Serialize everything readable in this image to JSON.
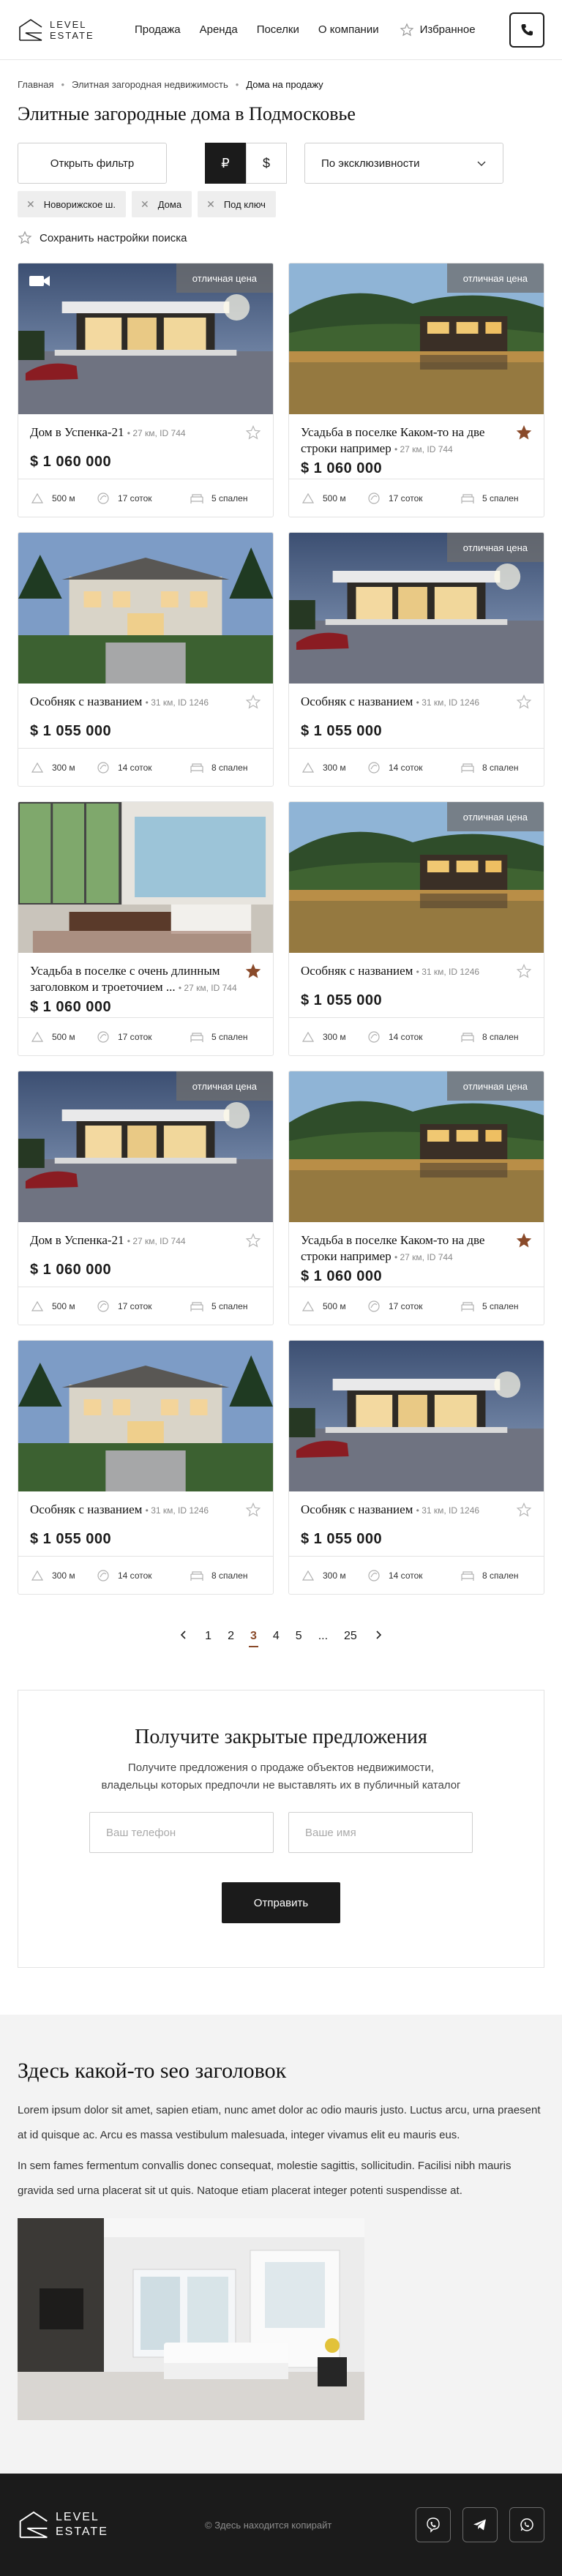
{
  "brand": {
    "line1": "LEVEL",
    "line2": "ESTATE"
  },
  "nav": [
    "Продажа",
    "Аренда",
    "Поселки",
    "О компании"
  ],
  "favorites_label": "Избранное",
  "breadcrumb": [
    "Главная",
    "Элитная загородная недвижимость",
    "Дома на продажу"
  ],
  "page_title": "Элитные загородные дома в Подмосковье",
  "controls": {
    "filter_label": "Открыть фильтр",
    "currency_rub": "₽",
    "currency_usd": "$",
    "sort_label": "По эксклюзивности"
  },
  "chips": [
    "Новорижское ш.",
    "Дома",
    "Под ключ"
  ],
  "save_search_label": "Сохранить настройки поиска",
  "accent_color": "#8a4a2a",
  "listings": [
    {
      "scene": "modern",
      "badge": "отличная цена",
      "video": true,
      "title": "Дом в Успенка-21",
      "meta": "• 27 км, ID 744",
      "fav": false,
      "price": "$ 1 060 000",
      "dist": "500 м",
      "area": "17 соток",
      "beds": "5 спален"
    },
    {
      "scene": "lake",
      "badge": "отличная цена",
      "video": false,
      "title": "Усадьба в поселке Каком-то на две строки например",
      "meta": "• 27 км, ID 744",
      "fav": true,
      "price": "$ 1 060 000",
      "dist": "500 м",
      "area": "17 соток",
      "beds": "5 спален"
    },
    {
      "scene": "mansion",
      "badge": "",
      "video": false,
      "title": "Особняк с названием",
      "meta": "• 31 км, ID 1246",
      "fav": false,
      "price": "$ 1 055 000",
      "dist": "300 м",
      "area": "14 соток",
      "beds": "8 спален"
    },
    {
      "scene": "modern",
      "badge": "отличная цена",
      "video": false,
      "title": "Особняк с названием",
      "meta": "• 31 км, ID 1246",
      "fav": false,
      "price": "$ 1 055 000",
      "dist": "300 м",
      "area": "14 соток",
      "beds": "8 спален"
    },
    {
      "scene": "interior",
      "badge": "",
      "video": false,
      "title": "Усадьба в поселке с очень длинным заголовком и троеточием ...",
      "meta": "• 27 км, ID 744",
      "fav": true,
      "price": "$ 1 060 000",
      "dist": "500 м",
      "area": "17 соток",
      "beds": "5 спален"
    },
    {
      "scene": "lake",
      "badge": "отличная цена",
      "video": false,
      "title": "Особняк с названием",
      "meta": "• 31 км, ID 1246",
      "fav": false,
      "price": "$ 1 055 000",
      "dist": "300 м",
      "area": "14 соток",
      "beds": "8 спален"
    },
    {
      "scene": "modern",
      "badge": "отличная цена",
      "video": false,
      "title": "Дом в Успенка-21",
      "meta": "• 27 км, ID 744",
      "fav": false,
      "price": "$ 1 060 000",
      "dist": "500 м",
      "area": "17 соток",
      "beds": "5 спален"
    },
    {
      "scene": "lake",
      "badge": "отличная цена",
      "video": false,
      "title": "Усадьба в поселке Каком-то на две строки например",
      "meta": "• 27 км, ID 744",
      "fav": true,
      "price": "$ 1 060 000",
      "dist": "500 м",
      "area": "17 соток",
      "beds": "5 спален"
    },
    {
      "scene": "mansion",
      "badge": "",
      "video": false,
      "title": "Особняк с названием",
      "meta": "• 31 км, ID 1246",
      "fav": false,
      "price": "$ 1 055 000",
      "dist": "300 м",
      "area": "14 соток",
      "beds": "8 спален"
    },
    {
      "scene": "modern",
      "badge": "",
      "video": false,
      "title": "Особняк с названием",
      "meta": "• 31 км, ID 1246",
      "fav": false,
      "price": "$ 1 055 000",
      "dist": "300 м",
      "area": "14 соток",
      "beds": "8 спален"
    }
  ],
  "pagination": {
    "pages": [
      "1",
      "2",
      "3",
      "4",
      "5",
      "...",
      "25"
    ],
    "current": "3"
  },
  "offers": {
    "title": "Получите закрытые предложения",
    "text1": "Получите предложения о продаже объектов недвижимости,",
    "text2": "владельцы которых предпочли не выставлять их в публичный каталог",
    "phone_placeholder": "Ваш телефон",
    "name_placeholder": "Ваше имя",
    "submit_label": "Отправить"
  },
  "seo": {
    "title": "Здесь какой-то seo заголовок",
    "p1": "Lorem ipsum dolor sit amet, sapien etiam, nunc amet dolor ac odio mauris justo. Luctus arcu, urna praesent at id quisque ac. Arcu es massa vestibulum malesuada, integer vivamus elit eu mauris eus.",
    "p2": "In sem fames fermentum convallis donec consequat, molestie sagittis, sollicitudin. Facilisi nibh mauris gravida sed urna placerat sit ut quis. Natoque etiam placerat integer potenti suspendisse at."
  },
  "footer": {
    "copyright": "© Здесь находится копирайт"
  }
}
